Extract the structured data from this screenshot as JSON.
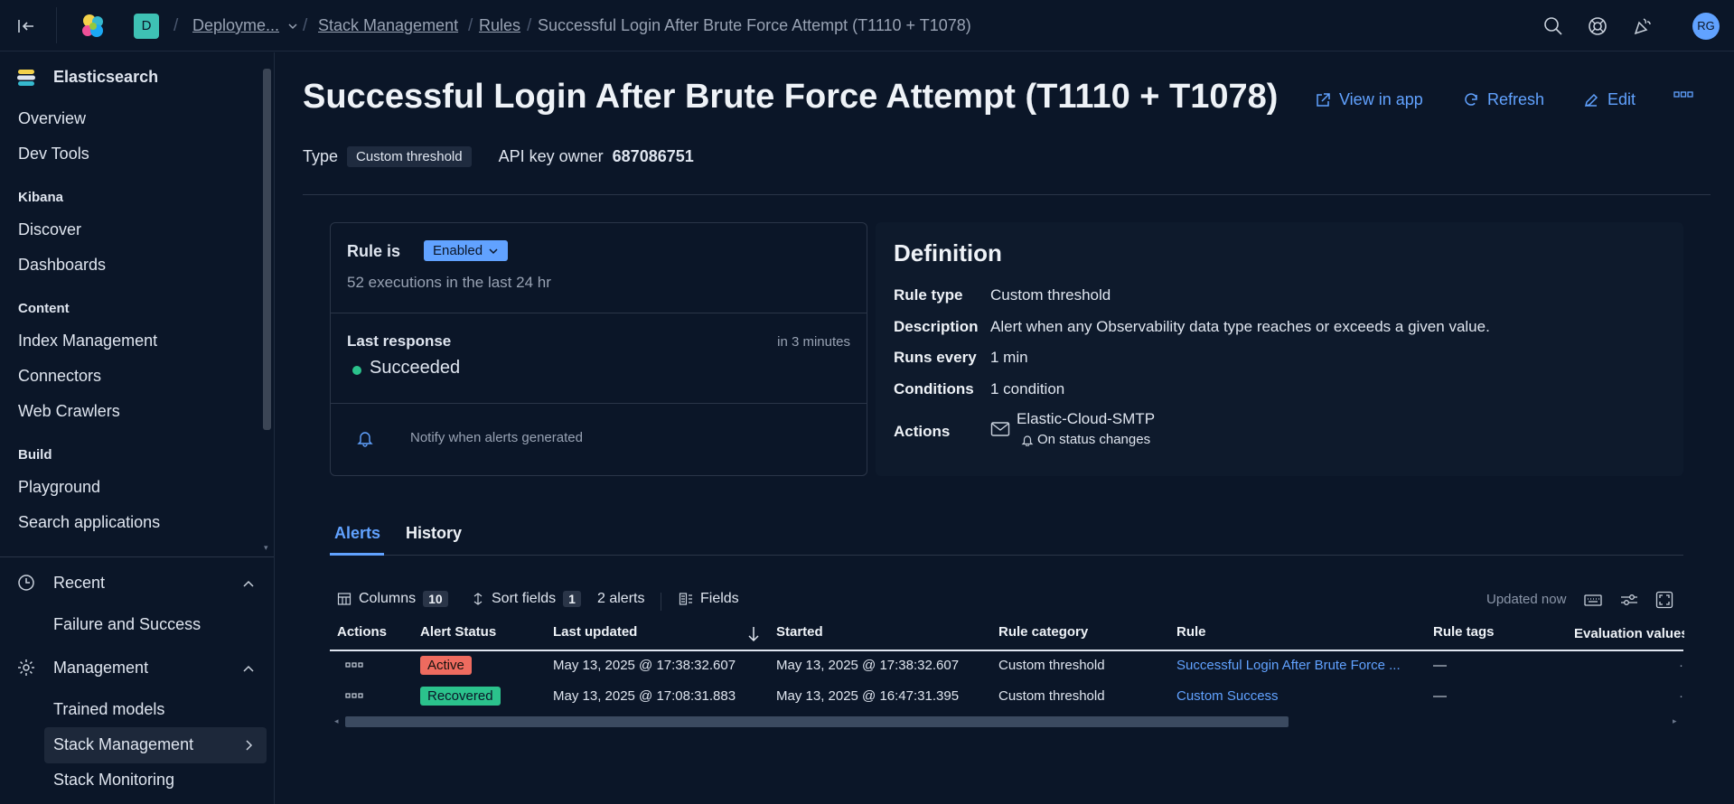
{
  "topbar": {
    "space_initial": "D",
    "breadcrumbs": [
      "Deployme...",
      "Stack Management",
      "Rules",
      "Successful Login After Brute Force Attempt (T1110 + T1078)"
    ],
    "avatar_initials": "RG"
  },
  "sidebar": {
    "app_title": "Elasticsearch",
    "items_top": [
      "Overview",
      "Dev Tools"
    ],
    "kibana_heading": "Kibana",
    "kibana_items": [
      "Discover",
      "Dashboards"
    ],
    "content_heading": "Content",
    "content_items": [
      "Index Management",
      "Connectors",
      "Web Crawlers"
    ],
    "build_heading": "Build",
    "build_items": [
      "Playground",
      "Search applications"
    ],
    "recent_label": "Recent",
    "recent_items": [
      "Failure and Success"
    ],
    "management_label": "Management",
    "management_items": [
      "Trained models",
      "Stack Management",
      "Stack Monitoring"
    ]
  },
  "header": {
    "title": "Successful Login After Brute Force Attempt (T1110 + T1078)",
    "view_in_app": "View in app",
    "refresh": "Refresh",
    "edit": "Edit",
    "type_label": "Type",
    "type_value": "Custom threshold",
    "api_key_owner_label": "API key owner",
    "api_key_owner_value": "687086751"
  },
  "status_panel": {
    "rule_is_label": "Rule is",
    "enabled_label": "Enabled",
    "executions_text": "52 executions in the last 24 hr",
    "last_response_label": "Last response",
    "next_run": "in 3 minutes",
    "last_response_value": "Succeeded",
    "notify_text": "Notify when alerts generated"
  },
  "definition": {
    "heading": "Definition",
    "rule_type_label": "Rule type",
    "rule_type_value": "Custom threshold",
    "description_label": "Description",
    "description_value": "Alert when any Observability data type reaches or exceeds a given value.",
    "runs_every_label": "Runs every",
    "runs_every_value": "1 min",
    "conditions_label": "Conditions",
    "conditions_value": "1 condition",
    "actions_label": "Actions",
    "action_connector": "Elastic-Cloud-SMTP",
    "action_frequency": "On status changes"
  },
  "tabs": [
    "Alerts",
    "History"
  ],
  "table_toolbar": {
    "columns_label": "Columns",
    "columns_count": "10",
    "sort_label": "Sort fields",
    "sort_count": "1",
    "alerts_count": "2 alerts",
    "fields_label": "Fields",
    "updated_text": "Updated now"
  },
  "table": {
    "headers": [
      "Actions",
      "Alert Status",
      "Last updated",
      "Started",
      "Rule category",
      "Rule",
      "Rule tags",
      "Evaluation values"
    ],
    "rows": [
      {
        "status": "Active",
        "last_updated": "May 13, 2025 @ 17:38:32.607",
        "started": "May 13, 2025 @ 17:38:32.607",
        "category": "Custom threshold",
        "rule": "Successful Login After Brute Force ...",
        "tags": "—"
      },
      {
        "status": "Recovered",
        "last_updated": "May 13, 2025 @ 17:08:31.883",
        "started": "May 13, 2025 @ 16:47:31.395",
        "category": "Custom threshold",
        "rule": "Custom Success",
        "tags": "—"
      }
    ]
  }
}
